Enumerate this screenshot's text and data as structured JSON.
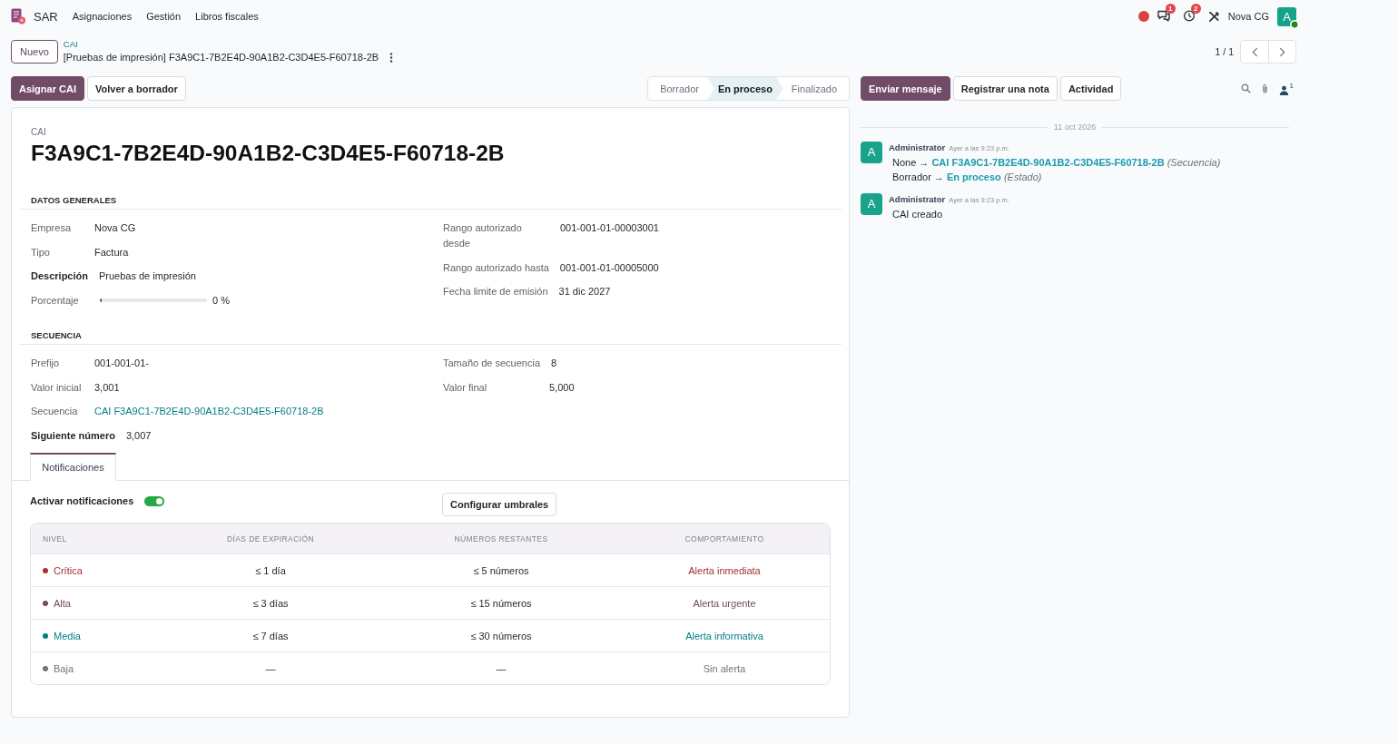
{
  "navbar": {
    "app_name": "SAR",
    "menu": [
      "Asignaciones",
      "Gestión",
      "Libros fiscales"
    ],
    "messages_badge": "1",
    "activities_badge": "2",
    "company": "Nova CG",
    "avatar_letter": "A"
  },
  "control_panel": {
    "new_button": "Nuevo",
    "breadcrumb": "CAI",
    "record_title": "[Pruebas de impresión] F3A9C1-7B2E4D-90A1B2-C3D4E5-F60718-2B",
    "pager": "1 / 1"
  },
  "action_buttons": [
    {
      "label": "Asignar CAI",
      "primary": true
    },
    {
      "label": "Volver a borrador",
      "primary": false
    }
  ],
  "statusbar": [
    {
      "label": "Borrador",
      "selected": false
    },
    {
      "label": "En proceso",
      "selected": true
    },
    {
      "label": "Finalizado",
      "selected": false
    }
  ],
  "form": {
    "name_label": "CAI",
    "name": "F3A9C1-7B2E4D-90A1B2-C3D4E5-F60718-2B",
    "sections": [
      {
        "title": "DATOS GENERALES",
        "left": [
          {
            "label": "Empresa",
            "value": "Nova CG",
            "kind": "text",
            "emphasized": false
          },
          {
            "label": "Tipo",
            "value": "Factura",
            "kind": "text",
            "emphasized": false
          },
          {
            "label": "Descripción",
            "value": "Pruebas de impresión",
            "kind": "text",
            "emphasized": true
          },
          {
            "label": "Porcentaje",
            "value": "0 %",
            "kind": "progress",
            "level": 0,
            "emphasized": false
          }
        ],
        "right": [
          {
            "label": "Rango autorizado desde",
            "value": "001-001-01-00003001",
            "kind": "text",
            "emphasized": false
          },
          {
            "label": "Rango autorizado hasta",
            "value": "001-001-01-00005000",
            "kind": "text",
            "emphasized": false
          },
          {
            "label": "Fecha limite de emisión",
            "value": "31 dic 2027",
            "kind": "text",
            "emphasized": false
          }
        ]
      },
      {
        "title": "SECUENCIA",
        "left": [
          {
            "label": "Prefijo",
            "value": "001-001-01-",
            "kind": "text",
            "emphasized": false
          },
          {
            "label": "Valor inicial",
            "value": "3,001",
            "kind": "text",
            "emphasized": false
          },
          {
            "label": "Secuencia",
            "value": "CAI F3A9C1-7B2E4D-90A1B2-C3D4E5-F60718-2B",
            "kind": "link",
            "emphasized": false
          },
          {
            "label": "Siguiente número",
            "value": "3,007",
            "kind": "text",
            "emphasized": true
          }
        ],
        "right": [
          {
            "label": "Tamaño de secuencia",
            "value": "8",
            "kind": "text",
            "emphasized": false
          },
          {
            "label": "Valor final",
            "value": "5,000",
            "kind": "text",
            "emphasized": false
          }
        ]
      }
    ]
  },
  "tabs": [
    {
      "label": "Notificaciones",
      "selected": true
    }
  ],
  "notifications": {
    "toggle": {
      "label": "Activar notificaciones",
      "on": true
    },
    "configure_button": "Configurar umbrales",
    "table": {
      "columns": [
        "NIVEL",
        "DÍAS DE EXPIRACIÓN",
        "NÚMEROS RESTANTES",
        "COMPORTAMIENTO"
      ],
      "rows": [
        {
          "name": "Crítica",
          "color": "#a23234",
          "days": "≤ 1 día",
          "numbers": "≤ 5 números",
          "behavior": "Alerta inmediata"
        },
        {
          "name": "Alta",
          "color": "#714b67",
          "days": "≤ 3 días",
          "numbers": "≤ 15 números",
          "behavior": "Alerta urgente"
        },
        {
          "name": "Media",
          "color": "#017e84",
          "days": "≤ 7 días",
          "numbers": "≤ 30 números",
          "behavior": "Alerta informativa"
        },
        {
          "name": "Baja",
          "color": "#6c757d",
          "days": "—",
          "numbers": "—",
          "behavior": "Sin alerta"
        }
      ]
    }
  },
  "chatter": {
    "buttons": [
      {
        "label": "Enviar mensaje",
        "primary": true
      },
      {
        "label": "Registrar una nota",
        "primary": false
      },
      {
        "label": "Actividad",
        "primary": false
      }
    ],
    "followers_count": "1",
    "date": "11 oct 2026",
    "messages": [
      {
        "author": "Administrator",
        "avatar_letter": "A",
        "time": "Ayer a las 9:23 p.m.",
        "kind": "tracking",
        "changes": [
          {
            "old": "None",
            "arrow": "→",
            "new": "CAI F3A9C1-7B2E4D-90A1B2-C3D4E5-F60718-2B",
            "field": "(Secuencia)"
          },
          {
            "old": "Borrador",
            "arrow": "→",
            "new": "En proceso",
            "field": "(Estado)"
          }
        ]
      },
      {
        "author": "Administrator",
        "avatar_letter": "A",
        "time": "Ayer a las 9:23 p.m.",
        "kind": "text",
        "body": "CAI creado"
      }
    ]
  }
}
